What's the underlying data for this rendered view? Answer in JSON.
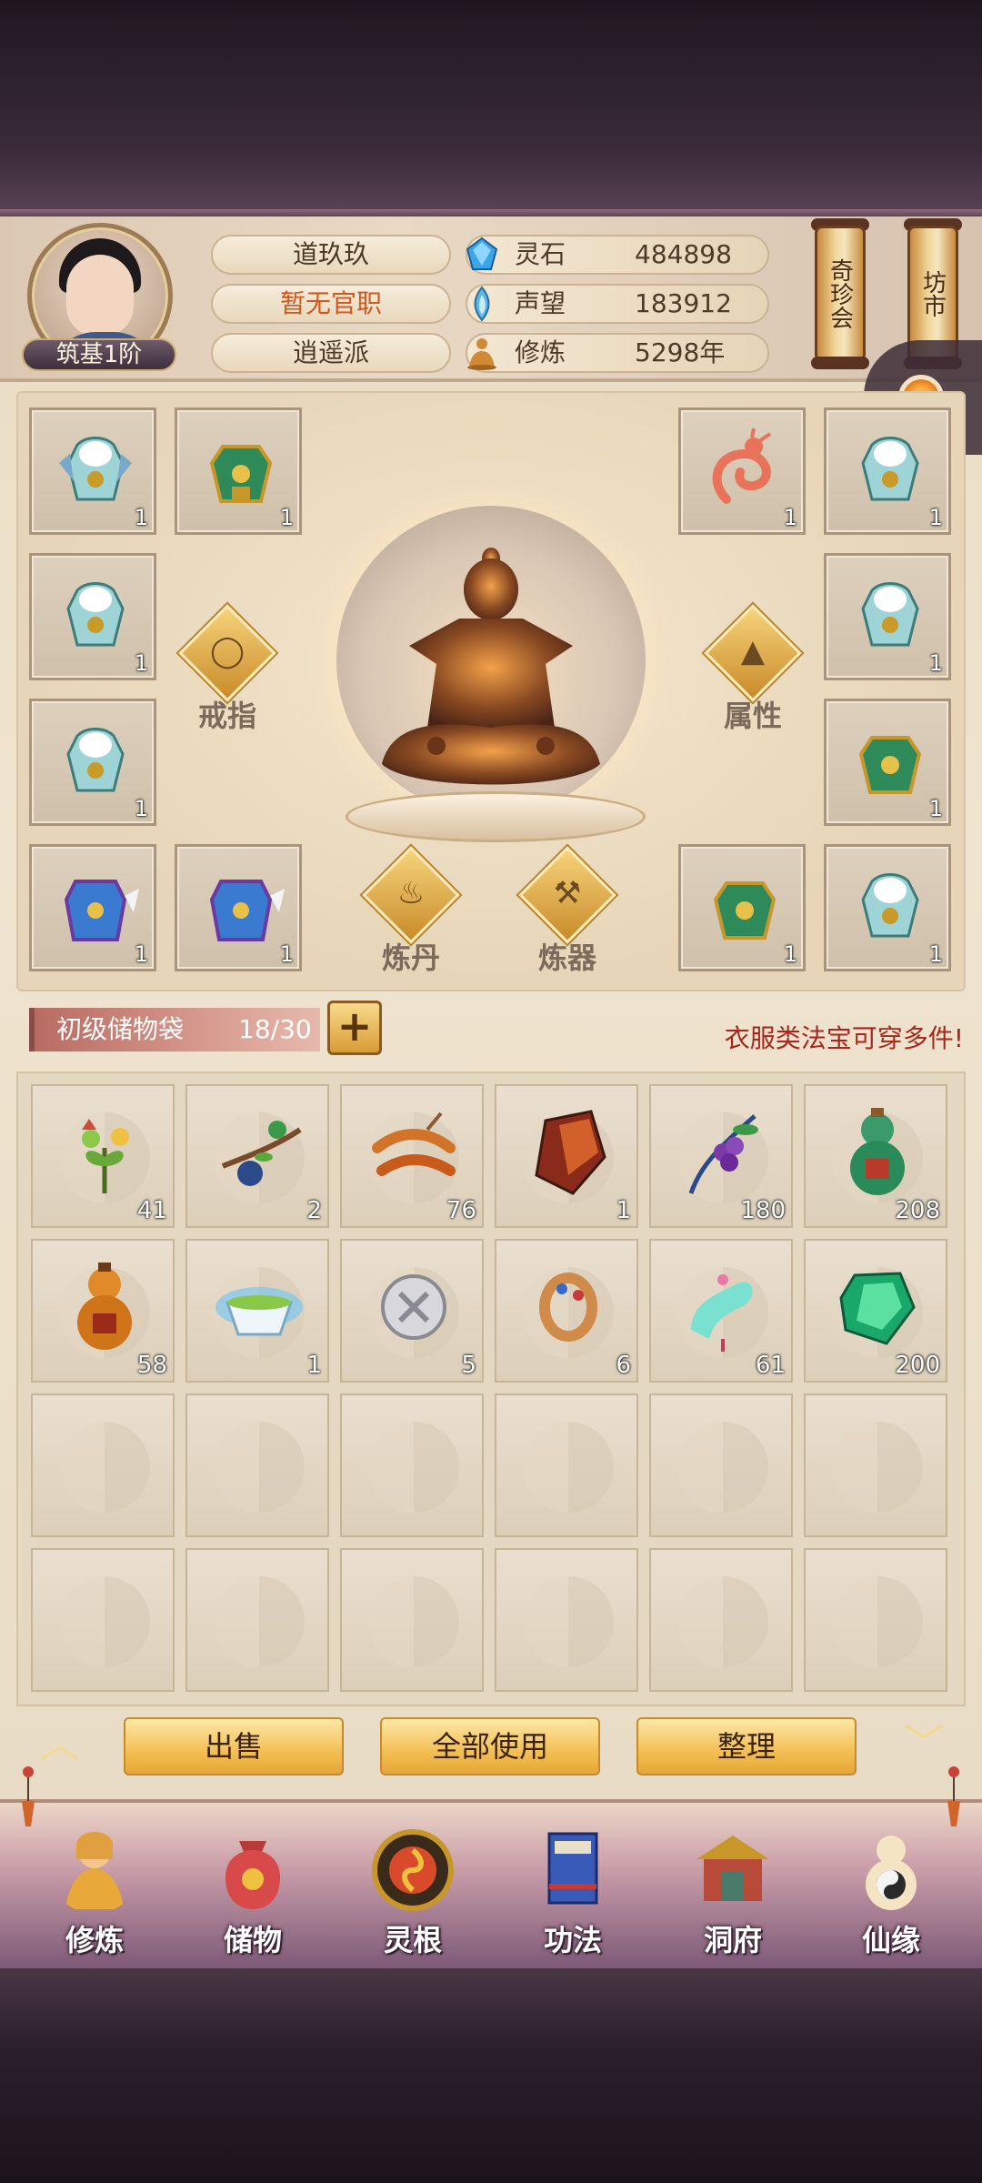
{
  "profile": {
    "rank": "筑基1阶",
    "name": "道玖玖",
    "official": "暂无官职",
    "sect": "逍遥派"
  },
  "stats": [
    {
      "icon": "spirit-stone-icon",
      "label": "灵石",
      "value": "484898"
    },
    {
      "icon": "reputation-icon",
      "label": "声望",
      "value": "183912"
    },
    {
      "icon": "cultivation-icon",
      "label": "修炼",
      "value": "5298年"
    }
  ],
  "top_buttons": {
    "treasure_fair": "奇珍会",
    "market": "坊市"
  },
  "equipment": {
    "hubs": {
      "ring": "戒指",
      "attributes": "属性",
      "alchemy": "炼丹",
      "forging": "炼器"
    },
    "slot_counts": {
      "l1a": "1",
      "l1b": "1",
      "r1a": "1",
      "r1b": "1",
      "l2": "1",
      "r2": "1",
      "l3": "1",
      "r3": "1",
      "l4a": "1",
      "l4b": "1",
      "r4a": "1",
      "r4b": "1"
    }
  },
  "bag": {
    "name": "初级储物袋",
    "count": "18/30",
    "tip": "衣服类法宝可穿多件!"
  },
  "inventory": {
    "counts": [
      "41",
      "2",
      "76",
      "1",
      "180",
      "208",
      "58",
      "1",
      "5",
      "6",
      "61",
      "200"
    ]
  },
  "actions": {
    "sell": "出售",
    "use_all": "全部使用",
    "sort": "整理"
  },
  "nav": {
    "cultivate": "修炼",
    "storage": "储物",
    "spirit_root": "灵根",
    "techniques": "功法",
    "cave": "洞府",
    "fate": "仙缘"
  },
  "colors": {
    "tip_red": "#a8261c",
    "official_orange": "#d4571c",
    "gold_button": "#f3bf54"
  }
}
